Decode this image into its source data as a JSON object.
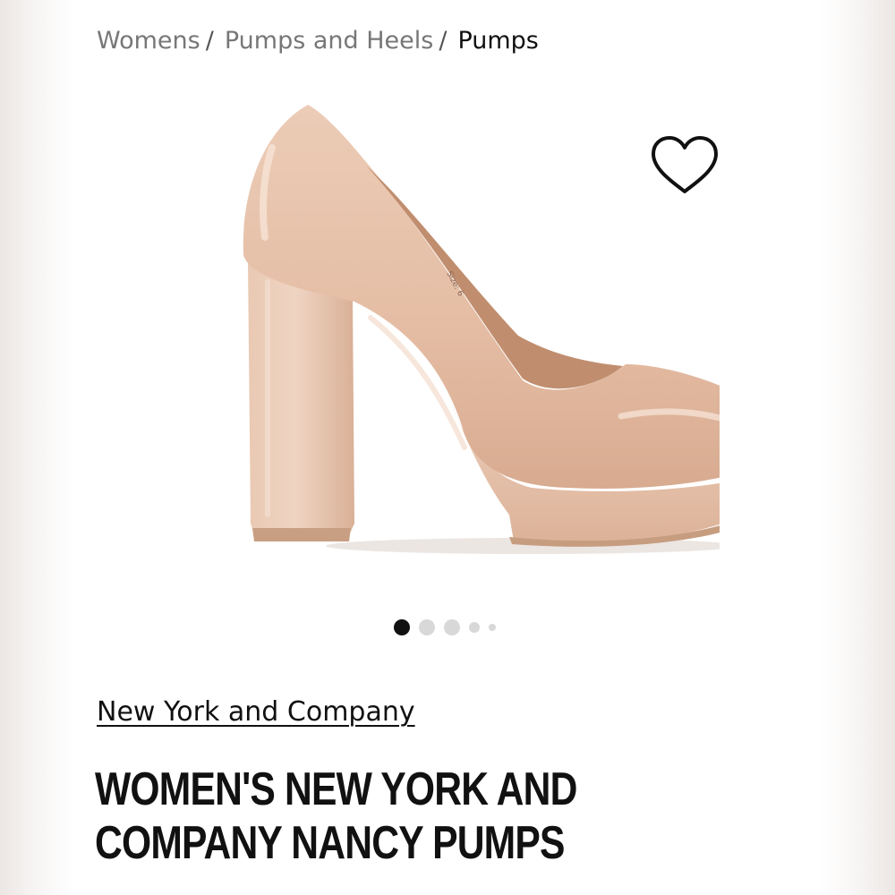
{
  "breadcrumb": {
    "items": [
      "Womens",
      "Pumps and Heels"
    ],
    "separator": "/",
    "current": "Pumps"
  },
  "wishlist": {
    "icon": "heart-outline-icon"
  },
  "product_image": {
    "subject": "nude patent platform block-heel pump",
    "insole_text": "Size: 6"
  },
  "carousel": {
    "total": 5,
    "active_index": 0
  },
  "product": {
    "brand": "New York and Company",
    "title_line1": "WOMEN'S NEW YORK AND",
    "title_line2": "COMPANY NANCY PUMPS"
  },
  "colors": {
    "shoe": "#e4bfa6",
    "shoe_shadow": "#c99c80",
    "text": "#111111",
    "breadcrumb_muted": "#777777"
  }
}
